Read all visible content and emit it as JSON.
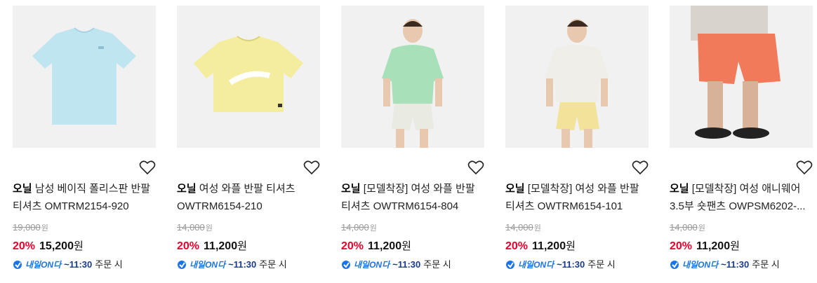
{
  "products": [
    {
      "brand": "오닐",
      "name": "남성 베이직 폴리스판 반팔 티셔츠 OMTRM2154-920",
      "original_price": "19,000",
      "won": "원",
      "discount": "20%",
      "price": "15,200",
      "shipping_badge": "내일ON다",
      "shipping_time": "~11:30",
      "shipping_tail": "주문 시",
      "image": "light-blue-tshirt"
    },
    {
      "brand": "오닐",
      "name": "여성 와플 반팔 티셔츠 OWTRM6154-210",
      "original_price": "14,000",
      "won": "원",
      "discount": "20%",
      "price": "11,200",
      "shipping_badge": "내일ON다",
      "shipping_time": "~11:30",
      "shipping_tail": "주문 시",
      "image": "yellow-crop-tshirt"
    },
    {
      "brand": "오닐",
      "name": "[모델착장] 여성 와플 반팔 티셔츠 OWTRM6154-804",
      "original_price": "14,000",
      "won": "원",
      "discount": "20%",
      "price": "11,200",
      "shipping_badge": "내일ON다",
      "shipping_time": "~11:30",
      "shipping_tail": "주문 시",
      "image": "model-mint-tshirt"
    },
    {
      "brand": "오닐",
      "name": "[모델착장] 여성 와플 반팔 티셔츠 OWTRM6154-101",
      "original_price": "14,000",
      "won": "원",
      "discount": "20%",
      "price": "11,200",
      "shipping_badge": "내일ON다",
      "shipping_time": "~11:30",
      "shipping_tail": "주문 시",
      "image": "model-white-tshirt"
    },
    {
      "brand": "오닐",
      "name": "[모델착장] 여성 애니웨어 3.5부 숏팬츠 OWPSM6202-...",
      "original_price": "14,000",
      "won": "원",
      "discount": "20%",
      "price": "11,200",
      "shipping_badge": "내일ON다",
      "shipping_time": "~11:30",
      "shipping_tail": "주문 시",
      "image": "model-coral-shorts"
    }
  ],
  "colors": {
    "discount": "#e4002b",
    "shipping_badge": "#1a73e8",
    "image_bg": "#f1f1f1"
  }
}
